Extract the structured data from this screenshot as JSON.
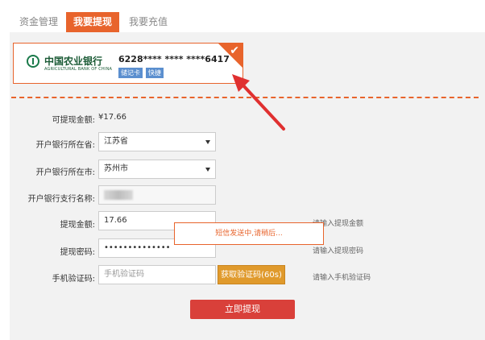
{
  "tabs": [
    {
      "label": "资金管理",
      "active": false
    },
    {
      "label": "我要提现",
      "active": true
    },
    {
      "label": "我要充值",
      "active": false
    }
  ],
  "bank_card": {
    "bank_name": "中国农业银行",
    "bank_name_en": "AGRICULTURAL BANK OF CHINA",
    "card_number": "6228**** **** ****6417",
    "card_type": "储记卡",
    "quick_tag": "快捷"
  },
  "form": {
    "available_label": "可提现金额:",
    "available_value": "¥17.66",
    "province_label": "开户银行所在省:",
    "province_value": "江苏省",
    "city_label": "开户银行所在市:",
    "city_value": "苏州市",
    "branch_label": "开户银行支行名称:",
    "amount_label": "提现金额:",
    "amount_value": "17.66",
    "amount_hint": "请输入提现金额",
    "password_label": "提现密码:",
    "password_value": "••••••••••••••",
    "password_hint": "请输入提现密码",
    "code_label": "手机验证码:",
    "code_placeholder": "手机验证码",
    "code_hint": "请输入手机验证码",
    "get_code_button": "获取验证码(60s)",
    "submit_button": "立即提现"
  },
  "toast": "短信发送中,请稍后...",
  "colors": {
    "accent": "#e8642c",
    "submit": "#d9403a",
    "code_button": "#e09a2c",
    "badge": "#5b8fcf"
  }
}
